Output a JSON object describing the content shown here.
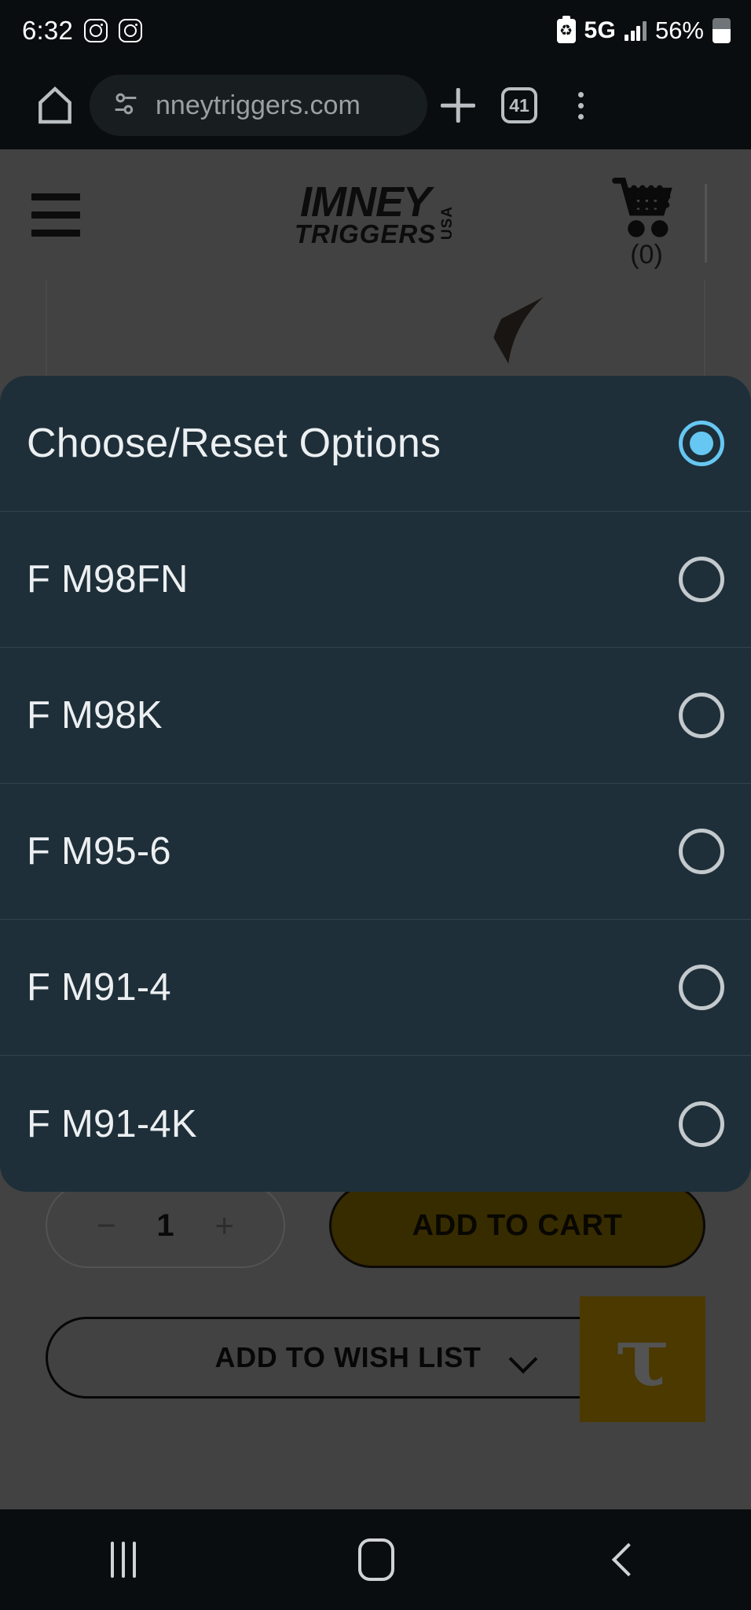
{
  "status_bar": {
    "clock": "6:32",
    "icons": [
      "instagram-icon",
      "instagram-icon"
    ],
    "battery_saver": "battery-saver-icon",
    "network": "5G",
    "signal": "signal-bars-icon",
    "battery_percent": "56%",
    "battery": "battery-icon"
  },
  "browser": {
    "home_icon": "home-icon",
    "site_settings_icon": "tune-icon",
    "url": "nneytriggers.com",
    "new_tab_icon": "plus-icon",
    "tab_count": "41",
    "menu_icon": "kebab-menu-icon"
  },
  "site": {
    "menu_icon": "hamburger-menu-icon",
    "logo_line1": "IMNEY",
    "logo_line2": "TRIGGERS",
    "logo_suffix": "USA",
    "cart_icon": "shopping-cart-icon",
    "cart_count": "(0)"
  },
  "modal": {
    "options": [
      {
        "label": "Choose/Reset Options",
        "selected": true
      },
      {
        "label": "F M98FN",
        "selected": false
      },
      {
        "label": "F M98K",
        "selected": false
      },
      {
        "label": "F M95-6",
        "selected": false
      },
      {
        "label": "F M91-4",
        "selected": false
      },
      {
        "label": "F M91-4K",
        "selected": false
      }
    ],
    "selected_color": "#66c7f2",
    "background_color": "#1e2f39"
  },
  "actions": {
    "qty_decrease": "−",
    "qty_value": "1",
    "qty_increase": "+",
    "add_to_cart": "ADD TO CART",
    "add_to_wish_list": "ADD TO WISH LIST",
    "wish_chevron": "chevron-down-icon",
    "widget_glyph": "τ",
    "accent_color": "#7d6000"
  },
  "nav_bar": {
    "recents": "recents-icon",
    "home": "home-square-icon",
    "back": "back-chevron-icon"
  }
}
